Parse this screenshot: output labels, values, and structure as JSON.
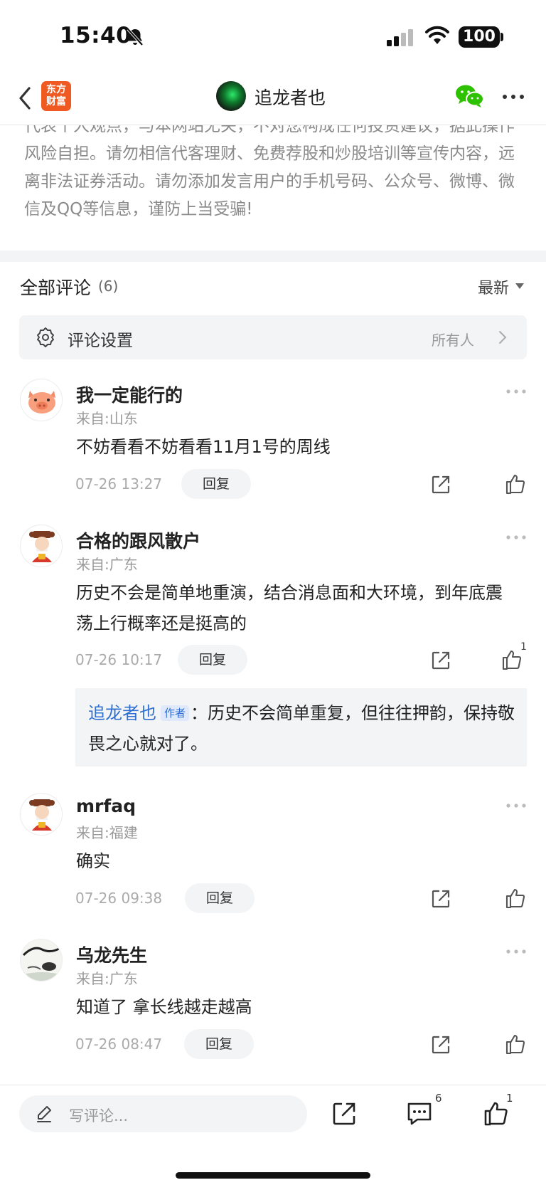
{
  "status_bar": {
    "time": "15:40",
    "battery": "100"
  },
  "nav": {
    "logo_line1": "东方",
    "logo_line2": "财富",
    "title": "追龙者也"
  },
  "disclaimer": "代表个人观点，与本网站无关，不对您构成任何投资建议，据此操作风险自担。请勿相信代客理财、免费荐股和炒股培训等宣传内容，远离非法证券活动。请勿添加发言用户的手机号码、公众号、微博、微信及QQ等信息，谨防上当受骗!",
  "comments_header": {
    "title": "全部评论",
    "count": "(6)",
    "sort": "最新"
  },
  "settings": {
    "label": "评论设置",
    "value": "所有人"
  },
  "comments": [
    {
      "name": "我一定能行的",
      "location": "来自:山东",
      "text": "不妨看看不妨看看11月1号的周线",
      "time": "07-26 13:27",
      "reply_label": "回复",
      "avatar": "pig"
    },
    {
      "name": "合格的跟风散户",
      "location": "来自:广东",
      "text": "历史不会是简单地重演，结合消息面和大环境，到年底震荡上行概率还是挺高的",
      "time": "07-26 10:17",
      "reply_label": "回复",
      "like_count": "1",
      "avatar": "fortune-god",
      "reply": {
        "author": "追龙者也",
        "tag": "作者",
        "separator": "：",
        "text": "历史不会简单重复，但往往押韵，保持敬畏之心就对了。"
      }
    },
    {
      "name": "mrfaq",
      "location": "来自:福建",
      "text": "确实",
      "time": "07-26 09:38",
      "reply_label": "回复",
      "avatar": "fortune-god"
    },
    {
      "name": "乌龙先生",
      "location": "来自:广东",
      "text": "知道了 拿长线越走越高",
      "time": "07-26 08:47",
      "reply_label": "回复",
      "avatar": "ink-painting"
    }
  ],
  "bottom_bar": {
    "placeholder": "写评论...",
    "comment_count": "6",
    "like_count": "1"
  },
  "colors": {
    "brand": "#ef5a22",
    "wechat": "#2dc100",
    "link": "#2f6fd0"
  }
}
